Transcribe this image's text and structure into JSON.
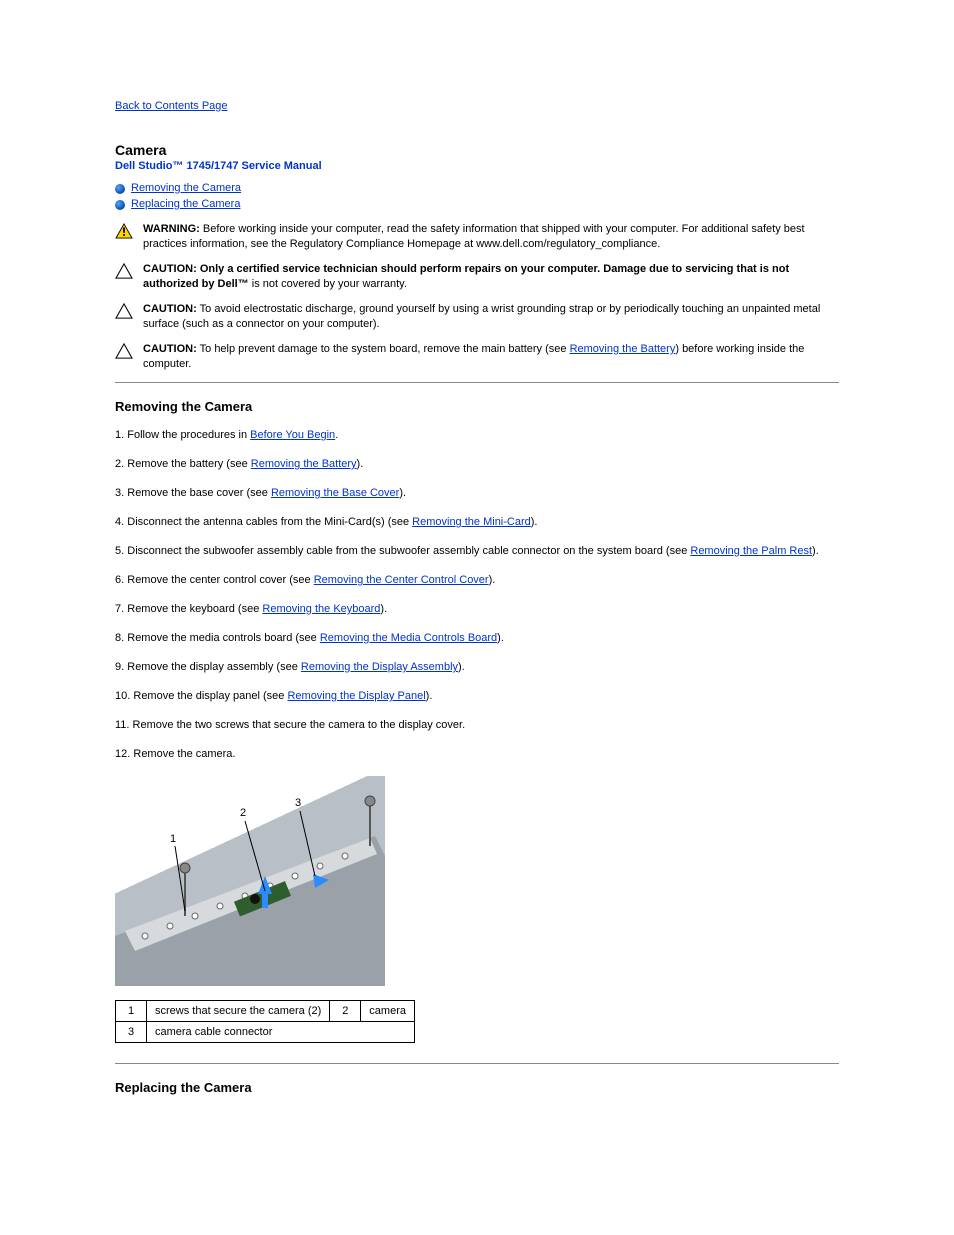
{
  "toc_link": "Back to Contents Page",
  "page_title": "Camera",
  "manual_title": "Dell Studio™ 1745/1747 Service Manual",
  "top_links": [
    "Removing the Camera",
    "Replacing the Camera"
  ],
  "notices": {
    "warning": {
      "label": "WARNING:",
      "text": "Before working inside your computer, read the safety information that shipped with your computer. For additional safety best practices information, see the Regulatory Compliance Homepage at www.dell.com/regulatory_compliance."
    },
    "caution1": {
      "label": "CAUTION:",
      "text_before": "Only a certified service technician should perform repairs on your computer. Damage due to servicing that is not authorized by Dell™ is not covered by your warranty.",
      "bold_part": "Only a certified service technician should perform repairs on your computer. Damage due to servicing that is not authorized by Dell™",
      "after_bold": " is not covered by your warranty."
    },
    "caution2": {
      "label": "CAUTION:",
      "text": "To avoid electrostatic discharge, ground yourself by using a wrist grounding strap or by periodically touching an unpainted metal surface (such as a connector on your computer)."
    },
    "caution3": {
      "label": "CAUTION:",
      "pre": "To help prevent damage to the system board, remove the main battery (see ",
      "link": "Removing the Battery",
      "post": ") before working inside the computer."
    }
  },
  "section": {
    "title": "Removing the Camera",
    "steps": [
      {
        "pre": "Follow the procedures in ",
        "link": "Before You Begin",
        "post": "."
      },
      {
        "pre": "Remove the battery (see ",
        "link": "Removing the Battery",
        "post": ")."
      },
      {
        "pre": "Remove the base cover (see ",
        "link": "Removing the Base Cover",
        "post": ")."
      },
      {
        "pre": "Disconnect the antenna cables from the Mini-Card(s) (see ",
        "link": "Removing the Mini-Card",
        "post": ")."
      },
      {
        "pre": "Disconnect the subwoofer assembly cable from the subwoofer assembly cable connector on the system board (see ",
        "link": "Removing the Palm Rest",
        "post": ")."
      },
      {
        "pre": "Remove the center control cover (see ",
        "link": "Removing the Center Control Cover",
        "post": ")."
      },
      {
        "pre": "Remove the keyboard (see ",
        "link": "Removing the Keyboard",
        "post": ")."
      },
      {
        "pre": "Remove the media controls board (see ",
        "link": "Removing the Media Controls Board",
        "post": ")."
      },
      {
        "pre": "Remove the display assembly (see ",
        "link": "Removing the Display Assembly",
        "post": ")."
      },
      {
        "pre": "Remove the display panel (see ",
        "link": "Removing the Display Panel",
        "post": ")."
      },
      {
        "pre": "Remove the two screws that secure the camera to the display cover.",
        "link": "",
        "post": ""
      },
      {
        "pre": "Remove the camera.",
        "link": "",
        "post": ""
      }
    ]
  },
  "callouts": {
    "r1c1": "1",
    "r1c2": "screws that secure the camera (2)",
    "r1c3": "2",
    "r1c4": "camera",
    "r2c1": "3",
    "r2c2": "camera cable connector"
  },
  "section2_title": "Replacing the Camera"
}
